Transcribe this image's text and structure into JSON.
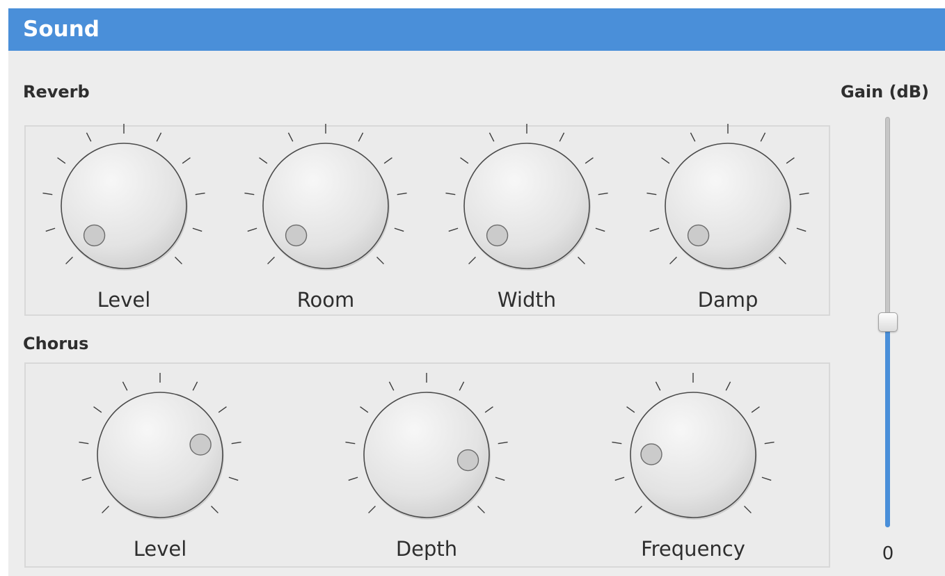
{
  "window": {
    "title": "Sound"
  },
  "reverb": {
    "label": "Reverb",
    "knobs": [
      {
        "label": "Level",
        "value": 0.0
      },
      {
        "label": "Room",
        "value": 0.0
      },
      {
        "label": "Width",
        "value": 0.0
      },
      {
        "label": "Damp",
        "value": 0.0
      }
    ]
  },
  "chorus": {
    "label": "Chorus",
    "knobs": [
      {
        "label": "Level",
        "value": 0.78
      },
      {
        "label": "Depth",
        "value": 0.86
      },
      {
        "label": "Frequency",
        "value": 0.17
      }
    ]
  },
  "gain": {
    "label": "Gain (dB)",
    "value": "0",
    "level": 0.5
  },
  "colors": {
    "accent": "#4a8fd9",
    "panel": "#ededed",
    "text": "#2e2e2e"
  }
}
